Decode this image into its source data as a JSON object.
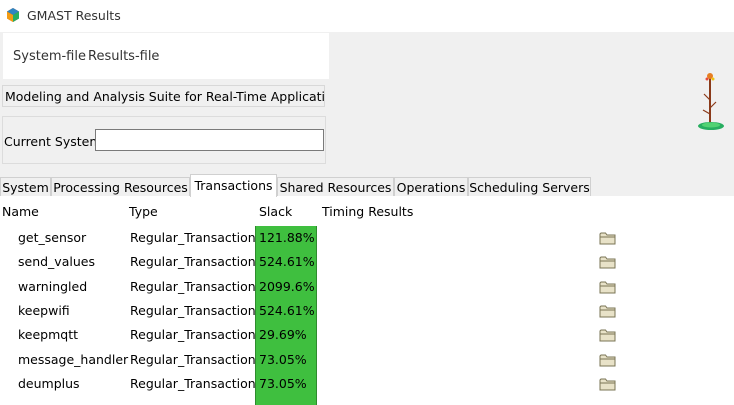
{
  "window": {
    "title": "GMAST Results"
  },
  "menu": {
    "items": [
      "System-file",
      "Results-file"
    ]
  },
  "suite_label": "Modeling and Analysis Suite for Real-Time Applications",
  "current_system": {
    "label": "Current System",
    "value": ""
  },
  "tabs": [
    "System",
    "Processing Resources",
    "Transactions",
    "Shared Resources",
    "Operations",
    "Scheduling Servers"
  ],
  "active_tab": "Transactions",
  "table": {
    "columns": [
      "Name",
      "Type",
      "Slack",
      "Timing Results"
    ],
    "rows": [
      {
        "name": "get_sensor",
        "type": "Regular_Transaction",
        "slack": "121.88%"
      },
      {
        "name": "send_values",
        "type": "Regular_Transaction",
        "slack": "524.61%"
      },
      {
        "name": "warningled",
        "type": "Regular_Transaction",
        "slack": "2099.6%"
      },
      {
        "name": "keepwifi",
        "type": "Regular_Transaction",
        "slack": "524.61%"
      },
      {
        "name": "keepmqtt",
        "type": "Regular_Transaction",
        "slack": "29.69%"
      },
      {
        "name": "message_handler",
        "type": "Regular_Transaction",
        "slack": "73.05%"
      },
      {
        "name": "deumplus",
        "type": "Regular_Transaction",
        "slack": "73.05%"
      }
    ],
    "timing_result_icon": "folder-icon"
  },
  "colors": {
    "slack_ok": "#3fbf3f",
    "window_bg": "#f0f0f0"
  }
}
